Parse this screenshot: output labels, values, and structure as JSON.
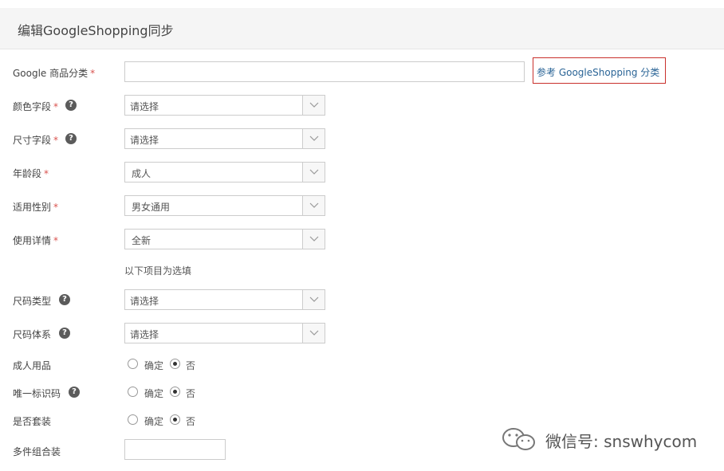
{
  "header": {
    "title": "编辑GoogleShopping同步"
  },
  "fields": {
    "google_category": {
      "label": "Google 商品分类",
      "value": "",
      "ref_link": "参考 GoogleShopping 分类"
    },
    "color_field": {
      "label": "颜色字段",
      "value": "请选择"
    },
    "size_field": {
      "label": "尺寸字段",
      "value": "请选择"
    },
    "age_group": {
      "label": "年龄段",
      "value": "成人"
    },
    "gender": {
      "label": "适用性别",
      "value": "男女通用"
    },
    "condition": {
      "label": "使用详情",
      "value": "全新"
    },
    "optional_note": "以下项目为选填",
    "size_type": {
      "label": "尺码类型",
      "value": "请选择"
    },
    "size_system": {
      "label": "尺码体系",
      "value": "请选择"
    },
    "adult": {
      "label": "成人用品",
      "options": [
        "确定",
        "否"
      ],
      "selected": "否"
    },
    "identifier": {
      "label": "唯一标识码",
      "options": [
        "确定",
        "否"
      ],
      "selected": "否"
    },
    "is_bundle": {
      "label": "是否套装",
      "options": [
        "确定",
        "否"
      ],
      "selected": "否"
    },
    "multipack": {
      "label": "多件组合装",
      "value": ""
    }
  },
  "required_mark": "*",
  "help_glyph": "?",
  "watermark": {
    "text": "微信号: snswhycom"
  },
  "colors": {
    "required": "#d9534f",
    "link": "#2a6496",
    "link_border": "#c9302c"
  }
}
